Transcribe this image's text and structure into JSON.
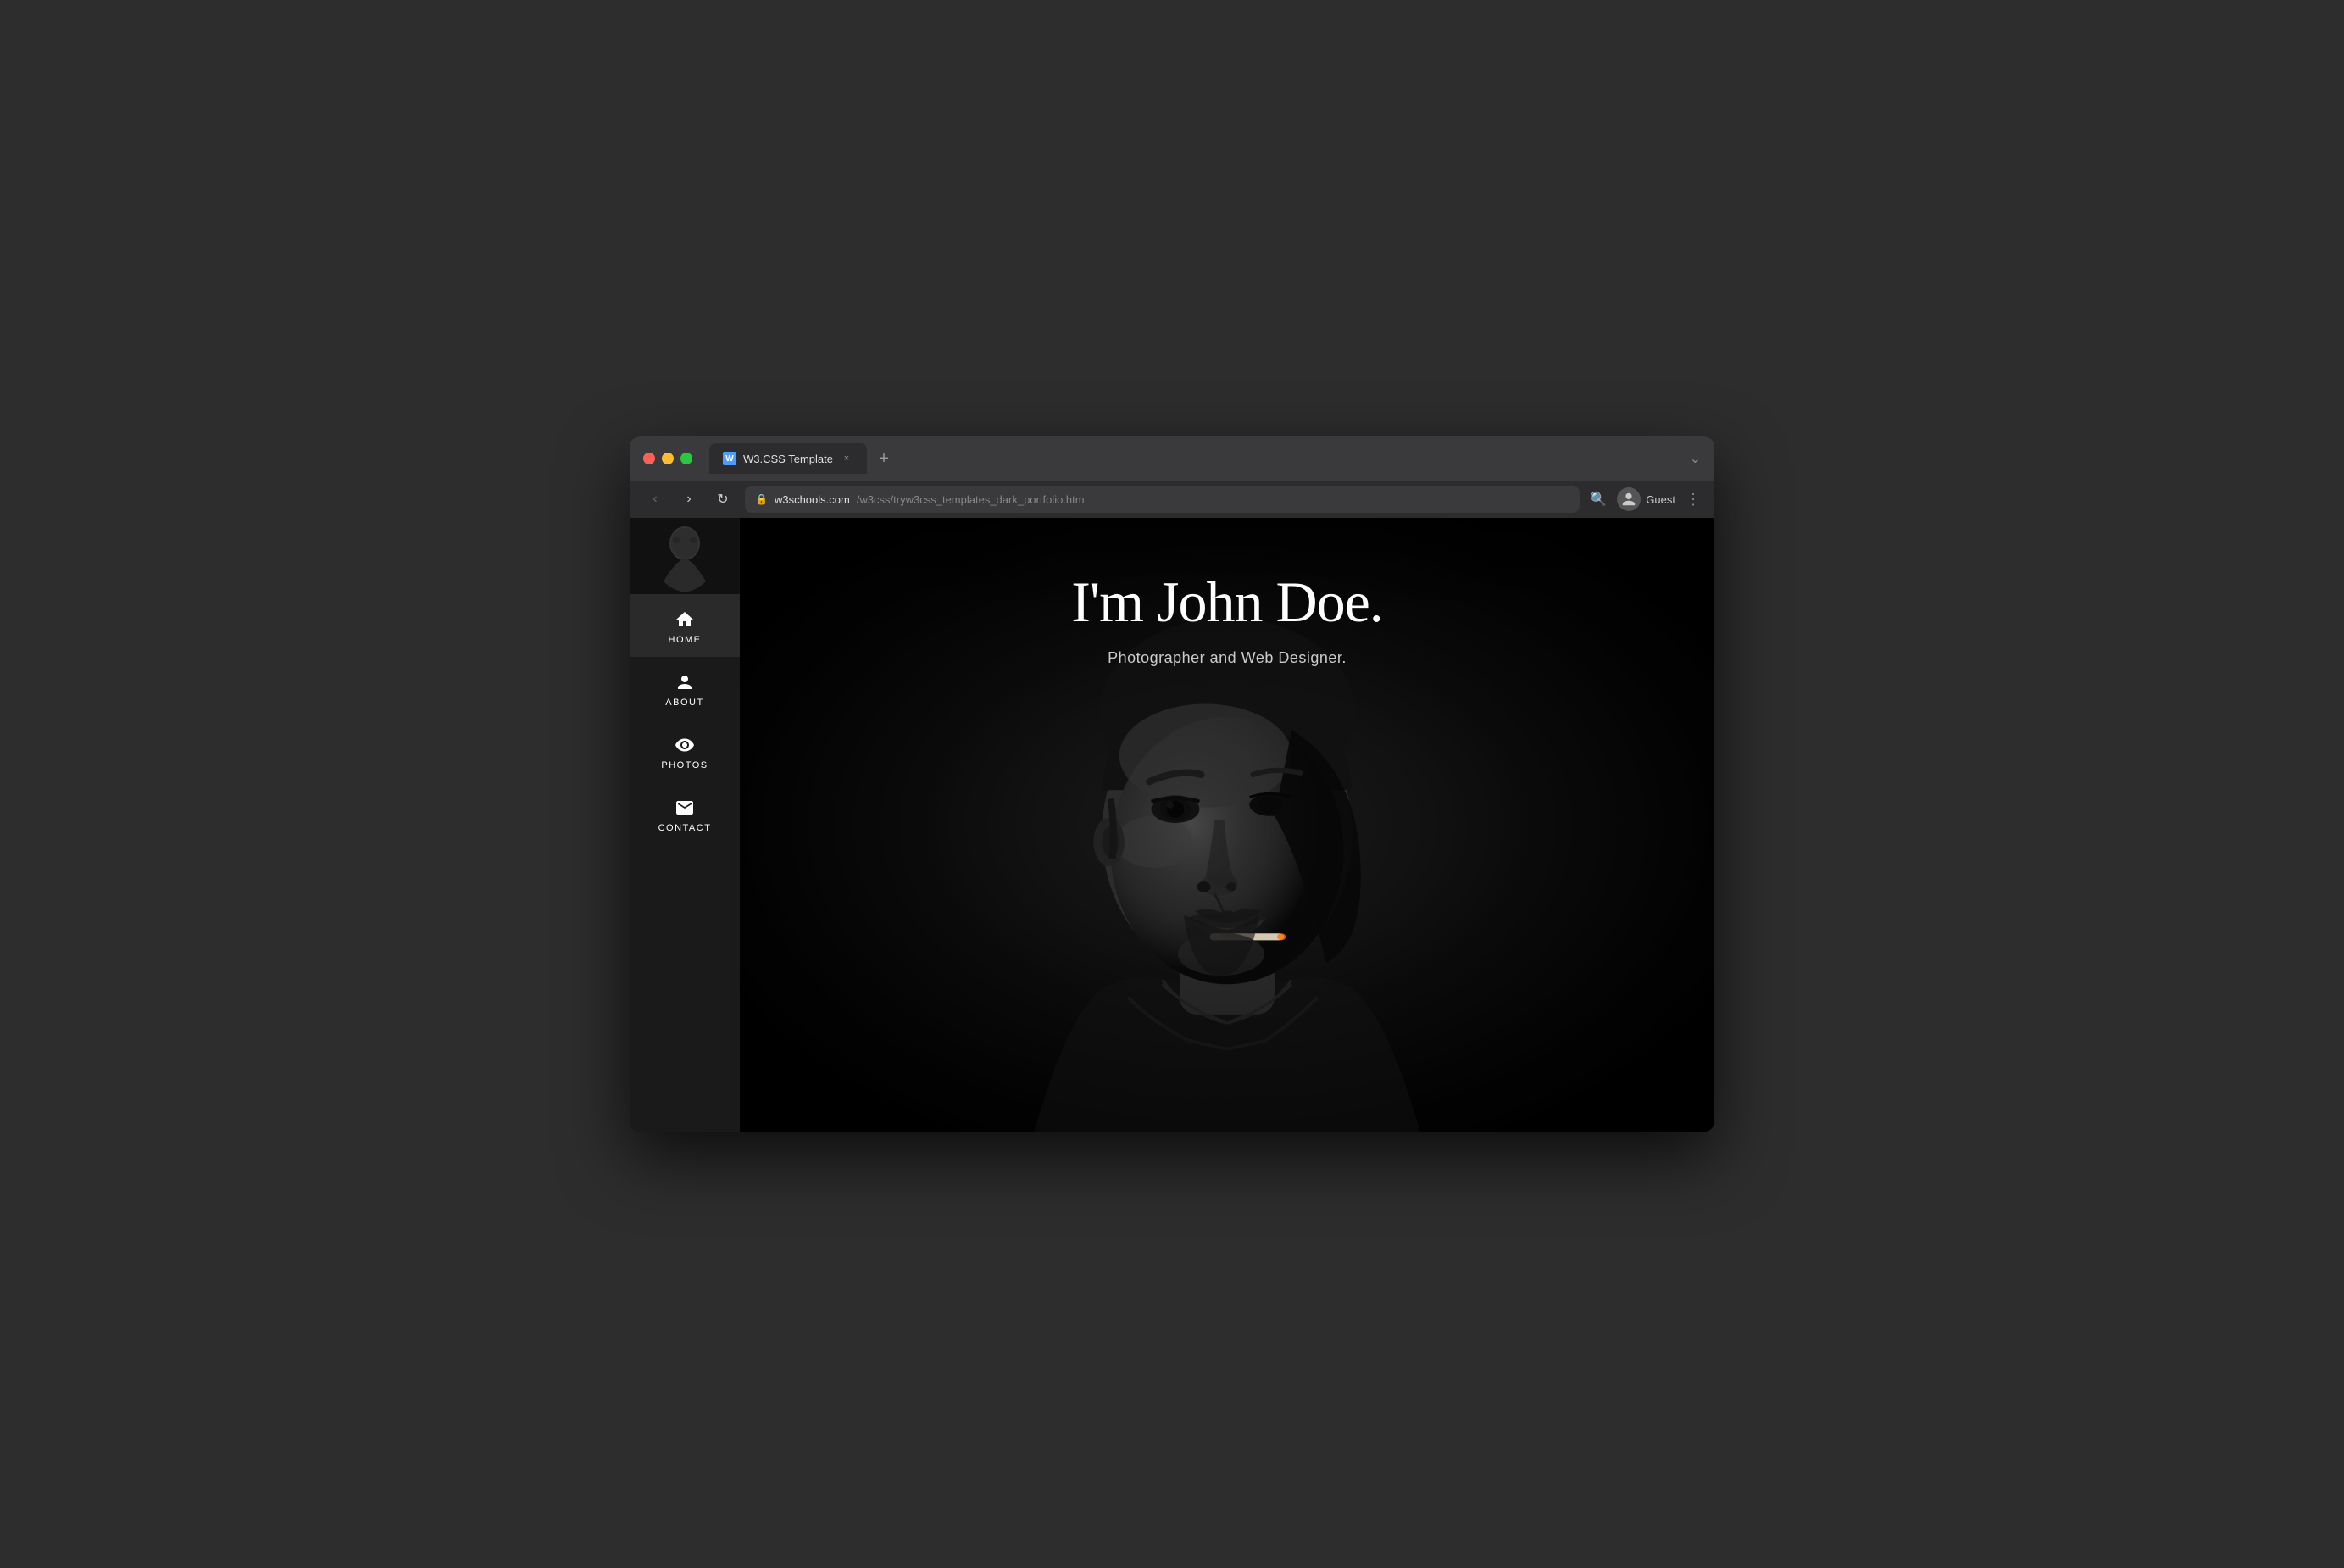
{
  "browser": {
    "tab_favicon": "W",
    "tab_title": "W3.CSS Template",
    "tab_close": "×",
    "tab_new": "+",
    "nav_back": "‹",
    "nav_forward": "›",
    "nav_refresh": "↻",
    "url_lock": "🔒",
    "url_domain": "w3schools.com",
    "url_path": "/w3css/tryw3css_templates_dark_portfolio.htm",
    "search_icon": "🔍",
    "user_icon": "👤",
    "guest_label": "Guest",
    "more_icon": "⋮",
    "chevron": "⌄"
  },
  "sidebar": {
    "nav_items": [
      {
        "id": "home",
        "label": "HOME",
        "icon": "home"
      },
      {
        "id": "about",
        "label": "ABOUT",
        "icon": "person"
      },
      {
        "id": "photos",
        "label": "PHOTOS",
        "icon": "eye"
      },
      {
        "id": "contact",
        "label": "CONTACT",
        "icon": "envelope"
      }
    ]
  },
  "hero": {
    "title": "I'm John Doe.",
    "subtitle": "Photographer and Web Designer."
  }
}
